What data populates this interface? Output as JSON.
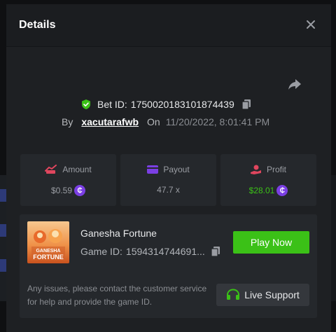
{
  "modal": {
    "title": "Details"
  },
  "bet": {
    "id_label": "Bet ID:",
    "id_value": "1750020183101874439",
    "by_label": "By",
    "username": "xacutarafwb",
    "on_label": "On",
    "date": "11/20/2022, 8:01:41 PM"
  },
  "stats": {
    "amount": {
      "label": "Amount",
      "value": "$0.59"
    },
    "payout": {
      "label": "Payout",
      "value": "47.7 x"
    },
    "profit": {
      "label": "Profit",
      "value": "$28.01"
    }
  },
  "currency_symbol": "₵",
  "game": {
    "thumb_line1": "GANESHA",
    "thumb_line2": "FORTUNE",
    "name": "Ganesha Fortune",
    "id_label": "Game ID:",
    "id_value": "1594314744691...",
    "play_label": "Play Now"
  },
  "support": {
    "text": "Any issues, please contact the customer service for help and provide the game ID.",
    "button_label": "Live Support"
  },
  "colors": {
    "accent_green": "#3bc117",
    "profit_green": "#3bc117",
    "coin_purple": "#7b3fe4",
    "amount_icon": "#e0465e",
    "payout_icon": "#7b3fe4",
    "profit_icon": "#e0465e"
  },
  "icons": {
    "close": "close-icon",
    "share": "share-icon",
    "shield": "shield-check-icon",
    "copy": "copy-icon",
    "amount": "bet-amount-icon",
    "payout": "wallet-icon",
    "profit": "profit-hand-icon",
    "headset": "headset-icon"
  }
}
